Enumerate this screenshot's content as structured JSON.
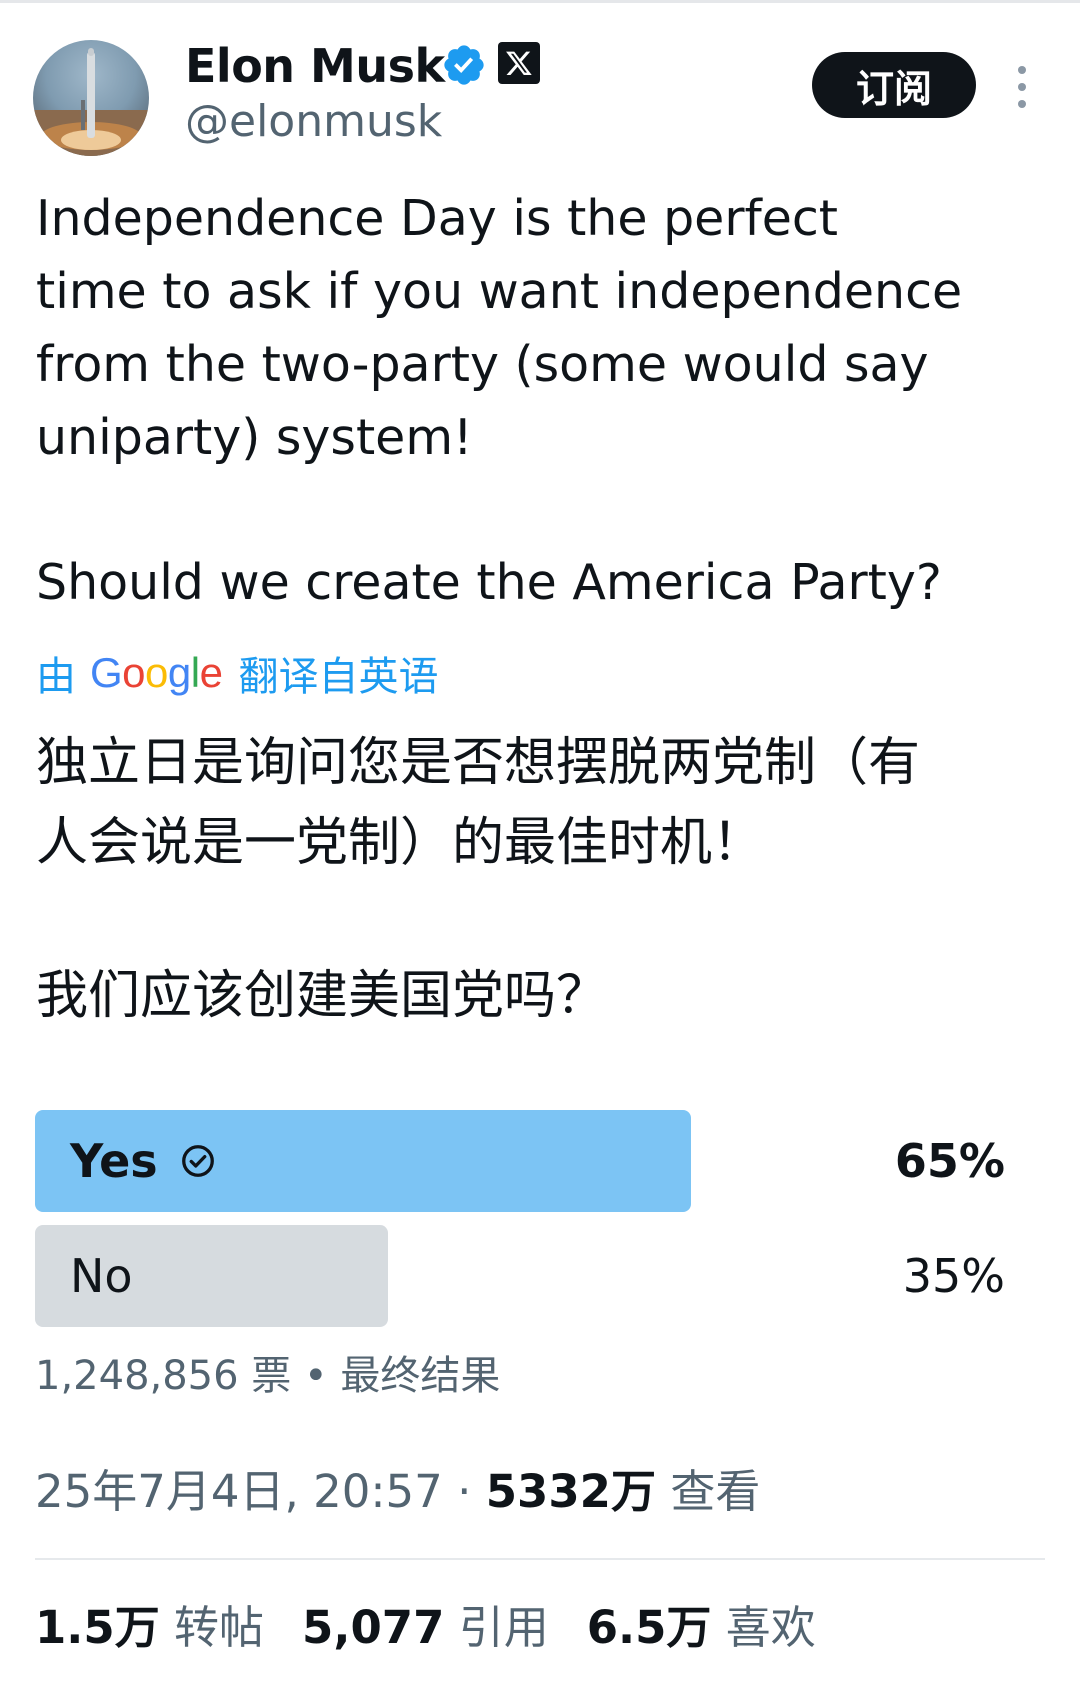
{
  "author": {
    "name": "Elon Musk",
    "handle": "@elonmusk"
  },
  "header": {
    "subscribe_label": "订阅"
  },
  "post": {
    "text": "Independence Day is the perfect\ntime to ask if you want independence\nfrom the two-party (some would say\nuniparty) system!",
    "question": "Should we create the America Party?"
  },
  "translation": {
    "prefix": "由",
    "brand": "Google",
    "suffix": "翻译自英语",
    "text": "独立日是询问您是否想摆脱两党制（有\n人会说是一党制）的最佳时机！",
    "question": "我们应该创建美国党吗？"
  },
  "poll": {
    "options": [
      {
        "label": "Yes",
        "percent": "65%",
        "share": 0.65,
        "winner": true
      },
      {
        "label": "No",
        "percent": "35%",
        "share": 0.35,
        "winner": false
      }
    ],
    "votes": "1,248,856",
    "votes_unit": "票",
    "separator": " • ",
    "status": "最终结果"
  },
  "meta": {
    "date": "25年7月4日, 20:57",
    "dot": " · ",
    "views_count": "5332万",
    "views_label": "查看"
  },
  "stats": {
    "reposts_count": "1.5万",
    "reposts_label": "转帖",
    "quotes_count": "5,077",
    "quotes_label": "引用",
    "likes_count": "6.5万",
    "likes_label": "喜欢"
  },
  "colors": {
    "accent": "#1d9bf0",
    "poll_winner": "#7cc4f4",
    "poll_other": "#d6dbdf",
    "secondary_text": "#536471"
  },
  "icons": {
    "verified": "verified-badge-icon",
    "x_logo": "x-logo-icon",
    "more": "more-vertical-icon",
    "poll_check": "check-circle-icon"
  }
}
